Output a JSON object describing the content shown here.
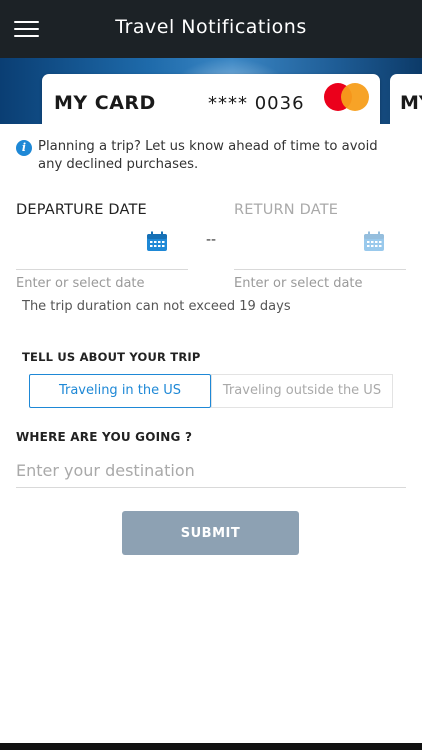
{
  "header": {
    "title": "Travel Notifications",
    "menu_icon": "hamburger-menu-icon",
    "background": "#1c2226"
  },
  "cards": [
    {
      "name": "MY CARD",
      "number": "**** 0036",
      "network_icon": "mastercard-logo"
    },
    {
      "name": "MY"
    }
  ],
  "info": {
    "icon": "info-icon",
    "text": "Planning a trip? Let us know ahead of time to avoid any declined purchases."
  },
  "dates": {
    "departure_label": "DEPARTURE DATE",
    "return_label": "RETURN DATE",
    "separator": "--",
    "departure_hint": "Enter or select date",
    "return_hint": "Enter or select date",
    "calendar_icon": "calendar-icon",
    "duration_note": "The trip duration can not exceed 19 days"
  },
  "trip": {
    "label": "TELL US ABOUT YOUR TRIP",
    "options": [
      {
        "label": "Traveling in the US",
        "selected": true
      },
      {
        "label": "Traveling outside the US",
        "selected": false
      }
    ]
  },
  "destination": {
    "label": "WHERE ARE YOU GOING ?",
    "placeholder": "Enter your destination",
    "value": ""
  },
  "submit": {
    "label": "SUBMIT",
    "color": "#8da1b3"
  },
  "colors": {
    "accent": "#1e88d6",
    "banner": "#1e6aaa"
  }
}
